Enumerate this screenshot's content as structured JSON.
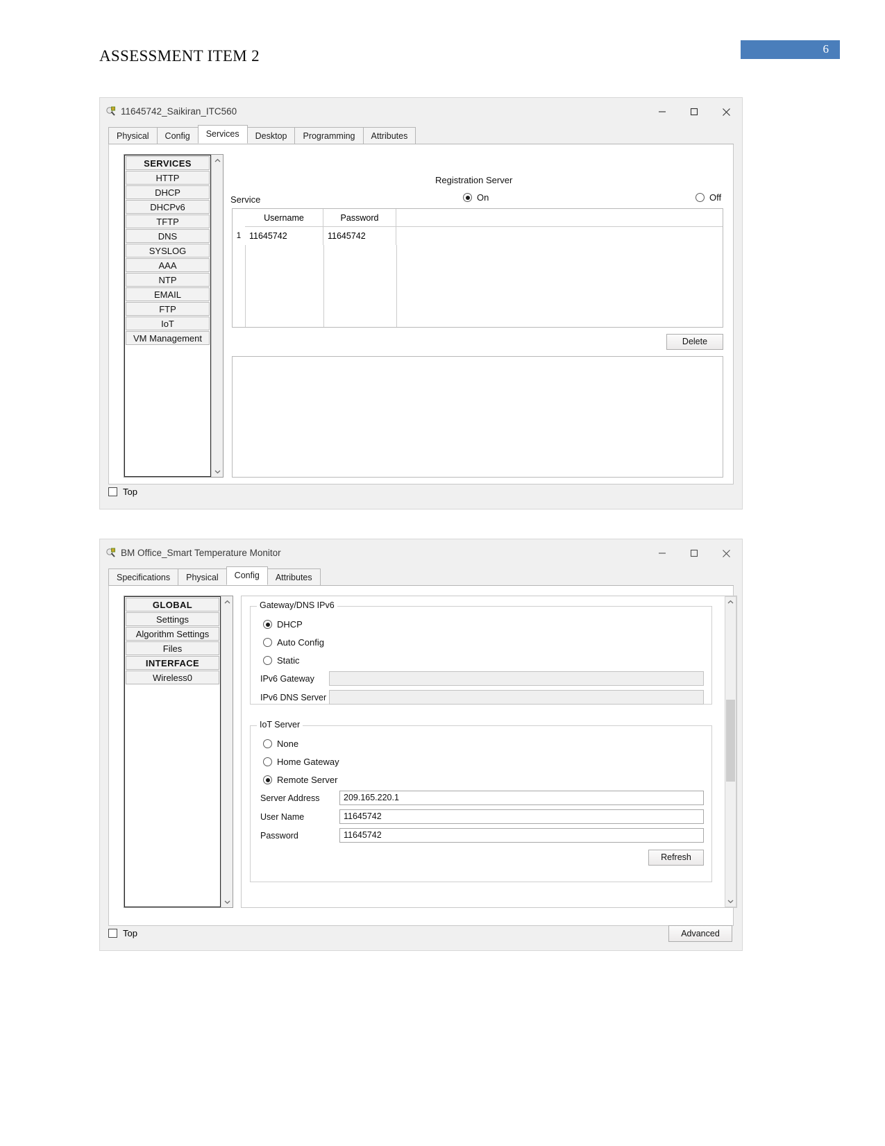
{
  "document": {
    "heading": "ASSESSMENT ITEM 2",
    "page_number": "6",
    "badge_color": "#4a7ebb"
  },
  "window1": {
    "title": "11645742_Saikiran_ITC560",
    "icon": "packet-tracer-icon",
    "controls": {
      "minimize": "minimize-icon",
      "maximize": "maximize-icon",
      "close": "close-icon"
    },
    "tabs": [
      {
        "label": "Physical",
        "active": false
      },
      {
        "label": "Config",
        "active": false
      },
      {
        "label": "Services",
        "active": true
      },
      {
        "label": "Desktop",
        "active": false
      },
      {
        "label": "Programming",
        "active": false
      },
      {
        "label": "Attributes",
        "active": false
      }
    ],
    "sidebar": [
      {
        "label": "SERVICES",
        "header": true
      },
      {
        "label": "HTTP",
        "header": false
      },
      {
        "label": "DHCP",
        "header": false
      },
      {
        "label": "DHCPv6",
        "header": false
      },
      {
        "label": "TFTP",
        "header": false
      },
      {
        "label": "DNS",
        "header": false
      },
      {
        "label": "SYSLOG",
        "header": false
      },
      {
        "label": "AAA",
        "header": false
      },
      {
        "label": "NTP",
        "header": false
      },
      {
        "label": "EMAIL",
        "header": false
      },
      {
        "label": "FTP",
        "header": false
      },
      {
        "label": "IoT",
        "header": false
      },
      {
        "label": "VM Management",
        "header": false
      }
    ],
    "content": {
      "panel_title": "Registration Server",
      "service_label": "Service",
      "radio_on": "On",
      "radio_off": "Off",
      "service_state": "On",
      "table": {
        "columns": [
          "Username",
          "Password"
        ],
        "rows": [
          {
            "index": "1",
            "username": "11645742",
            "password": "11645742"
          }
        ]
      },
      "delete_button": "Delete"
    },
    "footer": {
      "top_checkbox": "Top",
      "top_checked": false
    }
  },
  "window2": {
    "title": "BM Office_Smart Temperature Monitor",
    "icon": "packet-tracer-icon",
    "controls": {
      "minimize": "minimize-icon",
      "maximize": "maximize-icon",
      "close": "close-icon"
    },
    "tabs": [
      {
        "label": "Specifications",
        "active": false
      },
      {
        "label": "Physical",
        "active": false
      },
      {
        "label": "Config",
        "active": true
      },
      {
        "label": "Attributes",
        "active": false
      }
    ],
    "sidebar": [
      {
        "label": "GLOBAL",
        "header": true
      },
      {
        "label": "Settings",
        "header": false
      },
      {
        "label": "Algorithm Settings",
        "header": false
      },
      {
        "label": "Files",
        "header": false
      },
      {
        "label": "INTERFACE",
        "header": true
      },
      {
        "label": "Wireless0",
        "header": false
      }
    ],
    "gateway_group": {
      "title": "Gateway/DNS IPv6",
      "options": [
        {
          "label": "DHCP",
          "selected": true
        },
        {
          "label": "Auto Config",
          "selected": false
        },
        {
          "label": "Static",
          "selected": false
        }
      ],
      "fields": [
        {
          "label": "IPv6 Gateway",
          "value": ""
        },
        {
          "label": "IPv6 DNS Server",
          "value": ""
        }
      ]
    },
    "iot_group": {
      "title": "IoT Server",
      "options": [
        {
          "label": "None",
          "selected": false
        },
        {
          "label": "Home Gateway",
          "selected": false
        },
        {
          "label": "Remote Server",
          "selected": true
        }
      ],
      "fields": [
        {
          "label": "Server Address",
          "value": "209.165.220.1"
        },
        {
          "label": "User Name",
          "value": "11645742"
        },
        {
          "label": "Password",
          "value": "11645742"
        }
      ],
      "refresh_button": "Refresh"
    },
    "footer": {
      "top_checkbox": "Top",
      "top_checked": false,
      "advanced_button": "Advanced"
    }
  }
}
